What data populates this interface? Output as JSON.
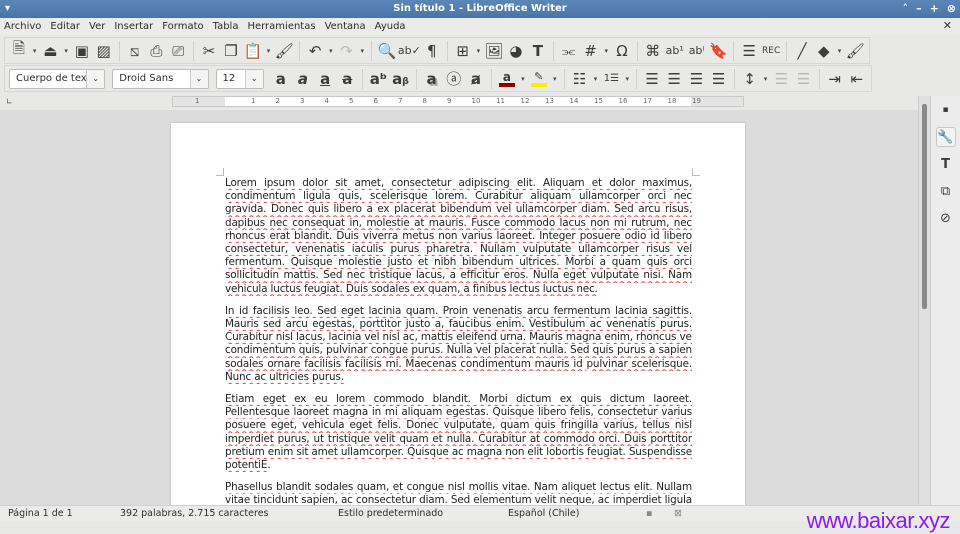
{
  "window": {
    "title": "Sin título 1 - LibreOffice Writer"
  },
  "menu": [
    "Archivo",
    "Editar",
    "Ver",
    "Insertar",
    "Formato",
    "Tabla",
    "Herramientas",
    "Ventana",
    "Ayuda"
  ],
  "format": {
    "paragraph_style": "Cuerpo de texto",
    "font_name": "Droid Sans",
    "font_size": "12"
  },
  "colors": {
    "font_color": "#8b0000",
    "highlight_color": "#f5f000"
  },
  "ruler": {
    "ticks": [
      "1",
      "1",
      "2",
      "3",
      "4",
      "5",
      "6",
      "7",
      "8",
      "9",
      "10",
      "11",
      "12",
      "13",
      "14",
      "15",
      "16",
      "17",
      "18",
      "19"
    ]
  },
  "document": {
    "paragraphs": [
      [
        "Lorem ipsum dolor sit amet, consectetur adipiscing elit. Aliquam et dolor maximus,",
        "condimentum ligula quis, scelerisque lorem. Curabitur aliquam ullamcorper orci nec",
        "gravida. Donec quis libero a ex placerat bibendum vel ullamcorper diam. Sed arcu risus,",
        "dapibus nec consequat in, molestie at mauris. Fusce commodo lacus non mi rutrum, nec",
        "rhoncus erat blandit. Duis viverra metus non varius laoreet. Integer posuere odio id libero",
        "consectetur, venenatis iaculis purus pharetra. Nullam vulputate ullamcorper risus vel",
        "fermentum. Quisque molestie justo et nibh bibendum ultrices. Morbi a quam quis orci",
        "sollicitudin mattis. Sed nec tristique lacus, a efficitur eros. Nulla eget vulputate nisi. Nam",
        "vehicula luctus feugiat. Duis sodales ex quam, a finibus lectus luctus nec."
      ],
      [
        "In id facilisis leo. Sed eget lacinia quam. Proin venenatis arcu fermentum lacinia sagittis.",
        "Mauris sed arcu egestas, porttitor justo a, faucibus enim. Vestibulum ac venenatis purus.",
        "Curabitur nisl lacus, lacinia vel nisl ac, mattis eleifend urna. Mauris magna enim, rhoncus vel",
        "condimentum quis, pulvinar congue purus. Nulla vel placerat nulla. Sed quis purus a sapien",
        "sodales ornare facilisis facilisis mi. Maecenas condimentum mauris id pulvinar scelerisque.",
        "Nunc ac ultricies purus."
      ],
      [
        "Etiam eget ex eu lorem commodo blandit. Morbi dictum ex quis dictum laoreet.",
        "Pellentesque laoreet magna in mi aliquam egestas. Quisque libero felis, consectetur varius",
        "posuere eget, vehicula eget felis. Donec vulputate, quam quis fringilla varius, tellus nisl",
        "imperdiet purus, ut tristique velit quam et nulla. Curabitur at commodo orci. Duis porttitor",
        "pretium enim sit amet ullamcorper. Quisque ac magna non elit lobortis feugiat. Suspendisse",
        "potentiE."
      ],
      [
        "Phasellus blandit sodales quam, et congue nisl mollis vitae. Nam aliquet lectus elit. Nullam",
        "vitae tincidunt sapien, ac consectetur diam. Sed elementum velit neque, ac imperdiet ligula"
      ]
    ]
  },
  "status": {
    "page": "Página 1 de 1",
    "words": "392 palabras, 2.715 caracteres",
    "style": "Estilo predeterminado",
    "language": "Español (Chile)"
  },
  "watermark": "www.baixar.xyz"
}
